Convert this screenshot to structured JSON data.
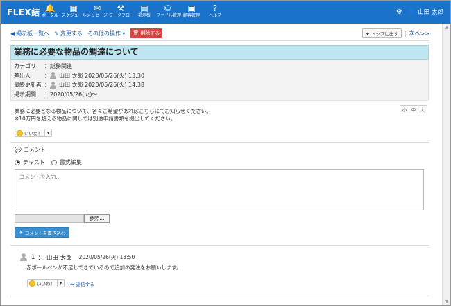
{
  "header": {
    "logo": "FLEX結",
    "nav": [
      {
        "label": "ポータル",
        "icon": "bell-icon",
        "glyph": "🔔"
      },
      {
        "label": "スケジュール",
        "icon": "calendar-icon",
        "glyph": "▦"
      },
      {
        "label": "メッセージ",
        "icon": "envelope-icon",
        "glyph": "✉"
      },
      {
        "label": "ワークフロー",
        "icon": "stamp-icon",
        "glyph": "⚒"
      },
      {
        "label": "掲示板",
        "icon": "board-icon",
        "glyph": "▤"
      },
      {
        "label": "ファイル管理",
        "icon": "drive-icon",
        "glyph": "⛁"
      },
      {
        "label": "顧客管理",
        "icon": "customer-icon",
        "glyph": "▣"
      },
      {
        "label": "ヘルプ",
        "icon": "help-icon",
        "glyph": "?"
      }
    ],
    "user_name": "山田 太郎"
  },
  "toolbar": {
    "back_label": "掲示板一覧へ",
    "edit_label": "変更する",
    "other_label": "その他の操作 ▾",
    "delete_label": "削除する",
    "top_label": "トップに出す",
    "next_label": "次へ>>"
  },
  "post": {
    "title": "業務に必要な物品の調達について",
    "meta": [
      {
        "key": "カテゴリ",
        "value": "総務関連",
        "avatar": false
      },
      {
        "key": "差出人",
        "value": "山田 太郎 2020/05/26(火) 13:30",
        "avatar": true
      },
      {
        "key": "最終更新者",
        "value": "山田 太郎 2020/05/26(火) 14:38",
        "avatar": true
      },
      {
        "key": "掲示期間",
        "value": "2020/05/26(火)〜",
        "avatar": false
      }
    ],
    "body_lines": [
      "業務に必要となる物品について、各々ご希望があればこちらにてお知らせください。",
      "※10万円を超える物品に関しては別途申請書類を提出してください。"
    ],
    "font_sizes": [
      "小",
      "中",
      "大"
    ],
    "like_label": "いいね！"
  },
  "comment_form": {
    "section_title": "コメント",
    "mode_text": "テキスト",
    "mode_rich": "書式編集",
    "placeholder": "コメントを入力...",
    "browse_label": "参照...",
    "submit_label": "コメントを書き込む"
  },
  "comments": [
    {
      "num": "1",
      "author": "山田 太郎",
      "date": "2020/05/26(火) 13:50",
      "body": "赤ボールペンが不足してきているので追加の発注をお願いします。",
      "like_label": "いいね！",
      "reply_label": "返信する"
    }
  ]
}
